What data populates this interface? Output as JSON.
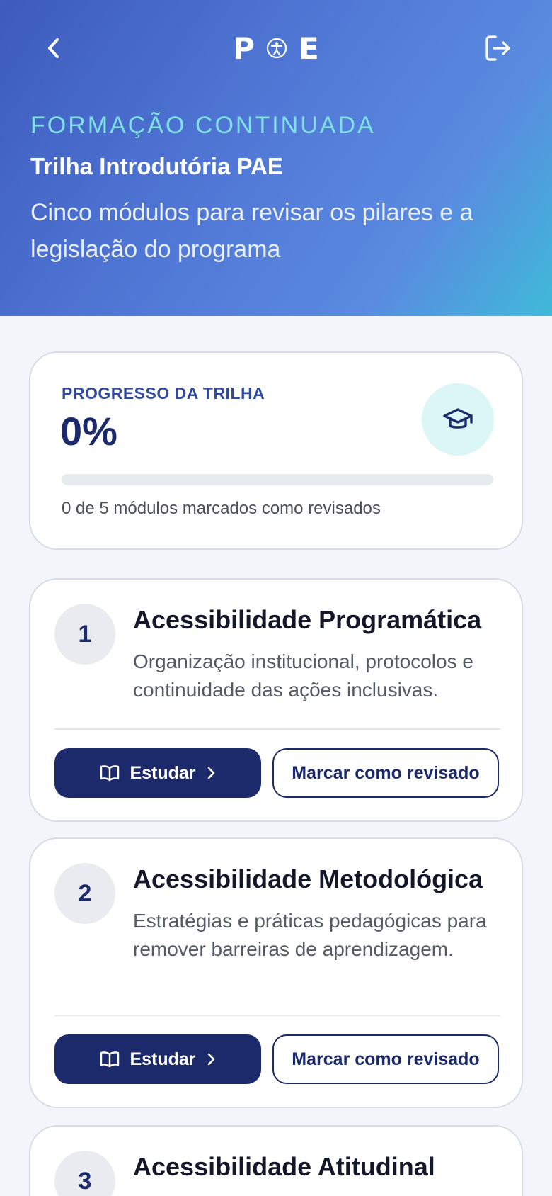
{
  "header": {
    "back_icon": "chevron-left-icon",
    "logo": {
      "left": "P",
      "right": "E",
      "mark_icon": "accessibility-icon"
    },
    "logout_icon": "logout-icon",
    "eyebrow": "FORMAÇÃO CONTINUADA",
    "title": "Trilha Introdutória PAE",
    "subtitle": "Cinco módulos para revisar os pilares e a legislação do programa"
  },
  "progress": {
    "label": "PROGRESSO DA TRILHA",
    "value": "0%",
    "fraction": 0,
    "caption": "0 de 5 módulos marcados como revisados",
    "icon": "graduation-cap-icon"
  },
  "modules": [
    {
      "number": "1",
      "title": "Acessibilidade Programática",
      "description": "Organização institucional, protocolos e continuidade das ações inclusivas.",
      "study_label": "Estudar",
      "mark_label": "Marcar como revisado"
    },
    {
      "number": "2",
      "title": "Acessibilidade Metodológica",
      "description": "Estratégias e práticas pedagógicas para remover barreiras de aprendizagem.",
      "study_label": "Estudar",
      "mark_label": "Marcar como revisado"
    },
    {
      "number": "3",
      "title": "Acessibilidade Atitudinal"
    }
  ],
  "colors": {
    "primary": "#1c2a6b",
    "accent": "#7fe0e6",
    "background": "#f3f5fa"
  }
}
